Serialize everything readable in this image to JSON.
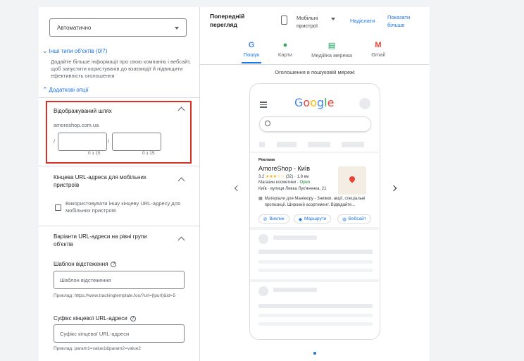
{
  "left": {
    "select_value": "Автоматично",
    "other_types_link": "Інші типи об'єктів (0/7)",
    "other_types_desc": "Додайте більше інформації про свою компанію і вебсайт, щоб запустити користувачів до взаємодії й підвищити ефективність оголошення",
    "extra_options_link": "Додаткові опції",
    "display_path": {
      "title": "Відображуваний шлях",
      "domain": "amoreshop.com.ua",
      "slash": "/",
      "counter1": "0 з 15",
      "counter2": "0 з 15"
    },
    "mobile_url": {
      "title": "Кінцева URL-адреса для мобільних пристроїв",
      "checkbox_label": "Використовувати іншу кінцеву URL-адресу для мобільних пристроїв"
    },
    "adgroup_url": {
      "title": "Варіанти URL-адреси на рівні групи об'єктів",
      "tracking_label": "Шаблон відстеження",
      "tracking_placeholder": "Шаблон відстеження",
      "tracking_example": "Приклад: https://www.trackingtemplate.foo/?url={lpurl}&id=5",
      "suffix_label": "Суфікс кінцевої URL-адреси",
      "suffix_placeholder": "Суфікс кінцевої URL-адреси",
      "suffix_example": "Приклад: param1=value1&param2=value2"
    }
  },
  "preview": {
    "title": "Попередній перегляд",
    "device_label": "Мобільні пристрої",
    "send_link": "Надіслати",
    "show_more_link": "Показати більше",
    "tabs": [
      {
        "label": "Пошук",
        "icon": "G",
        "color": "#4285f4"
      },
      {
        "label": "Карти",
        "icon": "●",
        "color": "#34a853"
      },
      {
        "label": "Медійна мережа",
        "icon": "▤",
        "color": "#0f9d58"
      },
      {
        "label": "Gmail",
        "icon": "M",
        "color": "#ea4335"
      }
    ],
    "network_caption": "Оголошення в пошуковій мережі",
    "google_logo": [
      "G",
      "o",
      "o",
      "g",
      "l",
      "e"
    ],
    "google_colors": [
      "#4285f4",
      "#ea4335",
      "#fbbc05",
      "#4285f4",
      "#34a853",
      "#ea4335"
    ],
    "ad": {
      "badge": "Реклама",
      "title": "AmoreShop - Київ",
      "rating": "3.2",
      "stars": "★★★☆☆",
      "reviews": "(32) · 1.8 км",
      "category": "Магазин косметики ·",
      "status": "Open",
      "address": "Київ · вулиця Левка Лук'яненка, 21",
      "description": "Матеріали для Манікюру - Знижки, акції, спеціальні пропозиції. Широкий асортимент. Відвідайте...",
      "buttons": [
        "Виклик",
        "Маршрути",
        "Вебсайт"
      ]
    }
  }
}
